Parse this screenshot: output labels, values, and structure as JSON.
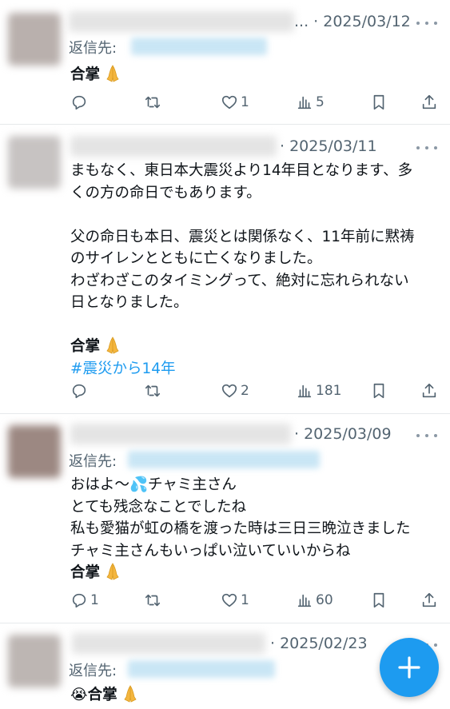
{
  "tweets": [
    {
      "date": "· 2025/03/12",
      "truncated_prefix": "...",
      "reply_label": "返信先:",
      "body_lines": [],
      "signoff": "合掌",
      "hashtag": "",
      "stats": {
        "reply": "",
        "retweet": "",
        "like": "1",
        "views": "5"
      },
      "avatar_color": "#b9b0ad"
    },
    {
      "date": "· 2025/03/11",
      "truncated_prefix": "",
      "reply_label": "",
      "body_lines": [
        "まもなく、東日本大震災より14年目となります、多",
        "くの方の命日でもあります。",
        "",
        "父の命日も本日、震災とは関係なく、11年前に黙祷",
        "のサイレンとともに亡くなりました。",
        "わざわざこのタイミングって、絶対に忘れられない",
        "日となりました。",
        ""
      ],
      "signoff": "合掌",
      "hashtag": "#震災から14年",
      "stats": {
        "reply": "",
        "retweet": "",
        "like": "2",
        "views": "181"
      },
      "avatar_color": "#c7c3c2"
    },
    {
      "date": "· 2025/03/09",
      "truncated_prefix": "",
      "reply_label": "返信先:",
      "body_lines": [
        "おはよ～💦チャミ主さん",
        "とても残念なことでしたね",
        "私も愛猫が虹の橋を渡った時は三日三晩泣きました",
        "チャミ主さんもいっぱい泣いていいからね"
      ],
      "signoff": "合掌",
      "hashtag": "",
      "stats": {
        "reply": "1",
        "retweet": "",
        "like": "1",
        "views": "60"
      },
      "avatar_color": "#9c8882"
    },
    {
      "date": "· 2025/02/23",
      "truncated_prefix": "",
      "reply_label": "返信先:",
      "body_lines": [],
      "signoff": "😭合掌",
      "hashtag": "",
      "stats": {
        "reply": "",
        "retweet": "",
        "like": "",
        "views": ""
      },
      "avatar_color": "#bdb6b3"
    }
  ],
  "signoff_emoji": "folded-hands-icon",
  "fab_icon": "plus-icon",
  "colors": {
    "accent": "#1d9bf0",
    "muted": "#536471",
    "divider": "#e6e9eb"
  }
}
